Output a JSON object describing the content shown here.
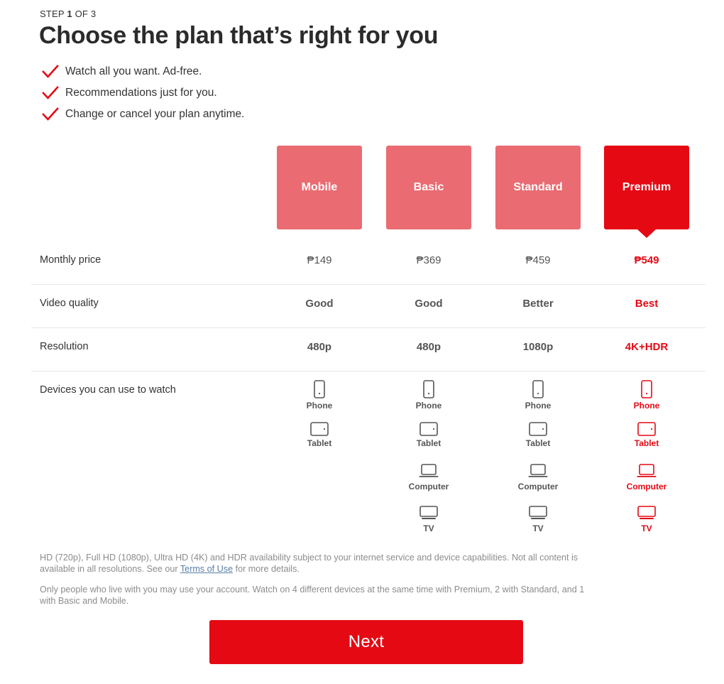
{
  "header": {
    "step_prefix": "STEP ",
    "step_current": "1",
    "step_suffix": " OF 3",
    "title": "Choose the plan that’s right for you",
    "bullets": [
      "Watch all you want. Ad-free.",
      "Recommendations just for you.",
      "Change or cancel your plan anytime."
    ]
  },
  "colors": {
    "brand_red": "#e50914",
    "card_unselected": "#ea6b72",
    "text_dark": "#333333",
    "text_muted": "#555555",
    "footnote": "#8c8c8c",
    "link_blue": "#5b7fa6",
    "divider": "#e6e6e6"
  },
  "plans": [
    {
      "name": "Mobile",
      "selected": false,
      "price": "₱149",
      "quality": "Good",
      "resolution": "480p",
      "devices": [
        "Phone",
        "Tablet"
      ]
    },
    {
      "name": "Basic",
      "selected": false,
      "price": "₱369",
      "quality": "Good",
      "resolution": "480p",
      "devices": [
        "Phone",
        "Tablet",
        "Computer",
        "TV"
      ]
    },
    {
      "name": "Standard",
      "selected": false,
      "price": "₱459",
      "quality": "Better",
      "resolution": "1080p",
      "devices": [
        "Phone",
        "Tablet",
        "Computer",
        "TV"
      ]
    },
    {
      "name": "Premium",
      "selected": true,
      "price": "₱549",
      "quality": "Best",
      "resolution": "4K+HDR",
      "devices": [
        "Phone",
        "Tablet",
        "Computer",
        "TV"
      ]
    }
  ],
  "rows": {
    "price_label": "Monthly price",
    "quality_label": "Video quality",
    "resolution_label": "Resolution",
    "devices_label": "Devices you can use to watch"
  },
  "icons": {
    "check": "check-icon",
    "phone": "phone-icon",
    "tablet": "tablet-icon",
    "computer": "computer-icon",
    "tv": "tv-icon"
  },
  "notes": {
    "line1_before_link": "HD (720p), Full HD (1080p), Ultra HD (4K) and HDR availability subject to your internet service and device capabilities. Not all content is available in all resolutions. See our ",
    "link_text": "Terms of Use",
    "line1_after_link": " for more details.",
    "line2": "Only people who live with you may use your account. Watch on 4 different devices at the same time with Premium, 2 with Standard, and 1 with Basic and Mobile."
  },
  "actions": {
    "next_label": "Next"
  }
}
